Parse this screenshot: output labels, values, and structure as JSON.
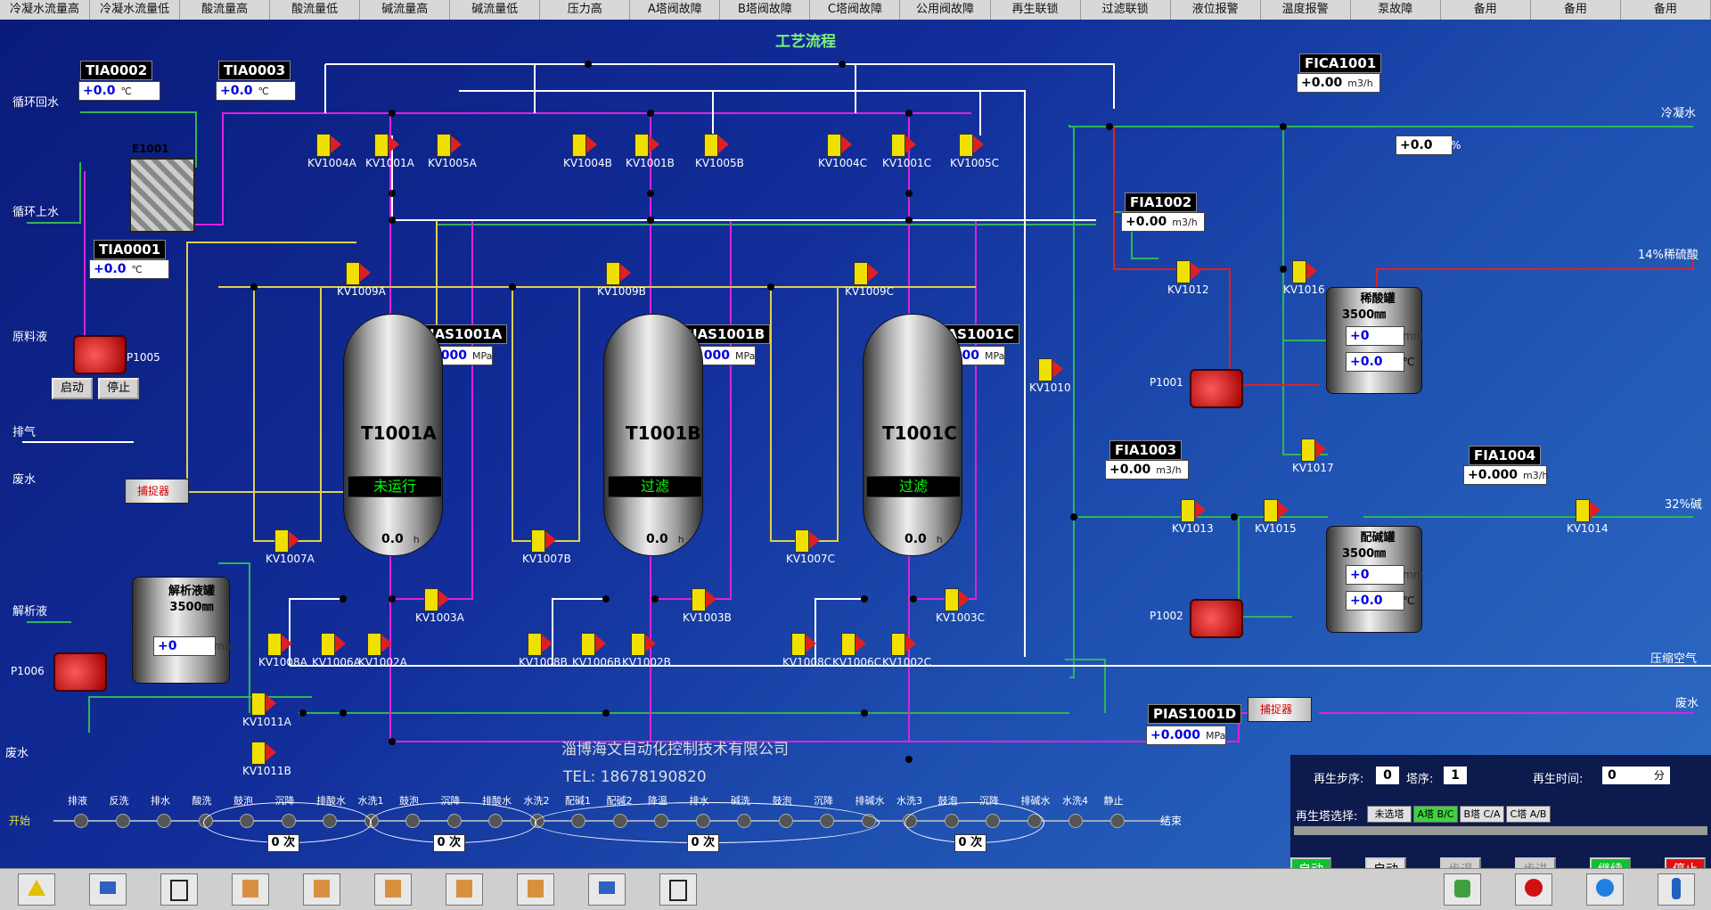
{
  "alarms": [
    "冷凝水流量高",
    "冷凝水流量低",
    "酸流量高",
    "酸流量低",
    "碱流量高",
    "碱流量低",
    "压力高",
    "A塔阀故障",
    "B塔阀故障",
    "C塔阀故障",
    "公用阀故障",
    "再生联锁",
    "过滤联锁",
    "液位报警",
    "温度报警",
    "泵故障",
    "备用",
    "备用",
    "备用"
  ],
  "title": "工艺流程",
  "company": "淄博海文自动化控制技术有限公司",
  "phone": "TEL:  18678190820",
  "colors": {
    "water": "#2fb55a",
    "acid": "#e02020",
    "magenta": "#e020e0",
    "white": "#ffffff",
    "yellow": "#e0d050"
  },
  "streams": {
    "circ_return": "循环回水",
    "circ_supply": "循环上水",
    "raw": "原料液",
    "vent": "排气",
    "waste1": "废水",
    "desorb": "解析液",
    "waste2": "废水",
    "cond": "冷凝水",
    "acid14": "14%稀硫酸",
    "base32": "32%碱",
    "air": "压缩空气",
    "waste3": "废水"
  },
  "instruments": {
    "TIA0002": {
      "tag": "TIA0002",
      "value": "+0.0",
      "unit": "℃"
    },
    "TIA0003": {
      "tag": "TIA0003",
      "value": "+0.0",
      "unit": "℃"
    },
    "TIA0001": {
      "tag": "TIA0001",
      "value": "+0.0",
      "unit": "℃"
    },
    "FICA1001": {
      "tag": "FICA1001",
      "value": "+0.00",
      "unit": "m3/h",
      "out": "+0.0",
      "out_unit": "%"
    },
    "FIA1002": {
      "tag": "FIA1002",
      "value": "+0.00",
      "unit": "m3/h"
    },
    "FIA1003": {
      "tag": "FIA1003",
      "value": "+0.00",
      "unit": "m3/h"
    },
    "FIA1004": {
      "tag": "FIA1004",
      "value": "+0.000",
      "unit": "m3/h"
    },
    "PIAS1001A": {
      "tag": "PIAS1001A",
      "value": "+0.000",
      "unit": "MPa"
    },
    "PIAS1001B": {
      "tag": "PIAS1001B",
      "value": "+0.000",
      "unit": "MPa"
    },
    "PIAS1001C": {
      "tag": "PIAS1001C",
      "value": "+0.000",
      "unit": "MPa"
    },
    "PIAS1001D": {
      "tag": "PIAS1001D",
      "value": "+0.000",
      "unit": "MPa"
    }
  },
  "equipment": {
    "E1001": "E1001",
    "P1005": "P1005",
    "P1006": "P1006",
    "P1001": "P1001",
    "P1002": "P1002",
    "trap1": "捕捉器",
    "trap2": "捕捉器"
  },
  "pump_buttons": {
    "start": "启动",
    "stop": "停止"
  },
  "towers": [
    {
      "name": "T1001A",
      "status": "未运行",
      "level": "0.0",
      "unit": "h"
    },
    {
      "name": "T1001B",
      "status": "过滤",
      "level": "0.0",
      "unit": "h"
    },
    {
      "name": "T1001C",
      "status": "过滤",
      "level": "0.0",
      "unit": "h"
    }
  ],
  "tanks": {
    "desorb": {
      "title": "解析液罐",
      "height": "3500㎜",
      "level": "+0",
      "unit": "mm"
    },
    "acid": {
      "title": "稀酸罐",
      "height": "3500㎜",
      "level": "+0",
      "unit": "mm",
      "temp": "+0.0",
      "temp_unit": "℃"
    },
    "base": {
      "title": "配碱罐",
      "height": "3500㎜",
      "level": "+0",
      "unit": "mm",
      "temp": "+0.0",
      "temp_unit": "℃"
    }
  },
  "valves": [
    "KV1004A",
    "KV1001A",
    "KV1005A",
    "KV1004B",
    "KV1001B",
    "KV1005B",
    "KV1004C",
    "KV1001C",
    "KV1005C",
    "KV1009A",
    "KV1009B",
    "KV1009C",
    "KV1007A",
    "KV1007B",
    "KV1007C",
    "KV1003A",
    "KV1003B",
    "KV1003C",
    "KV1008A",
    "KV1006A",
    "KV1002A",
    "KV1008B",
    "KV1006B",
    "KV1002B",
    "KV1008C",
    "KV1006C",
    "KV1002C",
    "KV1011A",
    "KV1011B",
    "KV1016",
    "KV1012",
    "KV1010",
    "KV1017",
    "KV1013",
    "KV1015",
    "KV1014"
  ],
  "sequence": {
    "start": "开始",
    "end": "结束",
    "steps": [
      "排液",
      "反洗",
      "排水",
      "酸洗",
      "鼓泡",
      "沉降",
      "排酸水",
      "水洗1",
      "鼓泡",
      "沉降",
      "排酸水",
      "水洗2",
      "配碱1",
      "配碱2",
      "降温",
      "排水",
      "碱洗",
      "鼓泡",
      "沉降",
      "排碱水",
      "水洗3",
      "鼓泡",
      "沉降",
      "排碱水",
      "水洗4",
      "静止"
    ],
    "loops": [
      {
        "value": "0",
        "unit": "次"
      },
      {
        "value": "0",
        "unit": "次"
      },
      {
        "value": "0",
        "unit": "次"
      },
      {
        "value": "0",
        "unit": "次"
      }
    ]
  },
  "panel": {
    "step_label": "再生步序:",
    "step_value": "0",
    "tower_label": "塔序:",
    "tower_value": "1",
    "time_label": "再生时间:",
    "time_value": "0",
    "time_unit": "分",
    "select_label": "再生塔选择:",
    "select_options": [
      "未选塔",
      "A塔 B/C",
      "B塔 C/A",
      "C塔 A/B"
    ],
    "buttons": [
      "自动",
      "启动",
      "步退",
      "步进",
      "继续",
      "停止"
    ]
  }
}
